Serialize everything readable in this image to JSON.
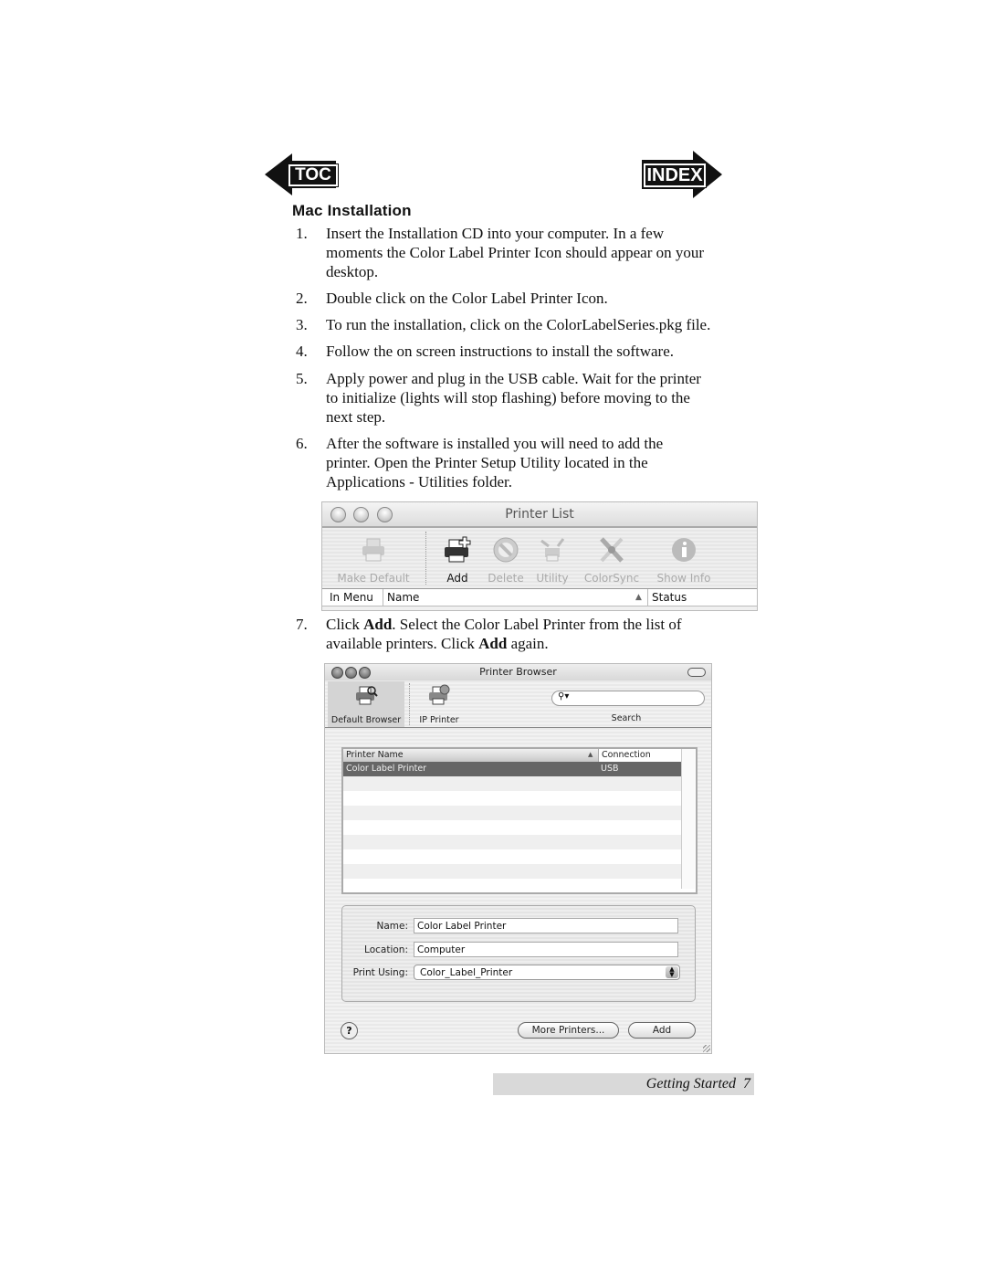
{
  "nav": {
    "toc_label": "TOC",
    "index_label": "INDEX"
  },
  "heading": "Mac Installation",
  "steps": [
    {
      "num": "1.",
      "lines": [
        "Insert the Installation CD into your computer. In a few",
        "moments the Color Label Printer Icon should appear on your",
        "desktop."
      ]
    },
    {
      "num": "2.",
      "lines": [
        "Double click on the Color Label Printer Icon."
      ]
    },
    {
      "num": "3.",
      "lines": [
        "To run the installation, click on the ColorLabelSeries.pkg file."
      ]
    },
    {
      "num": "4.",
      "lines": [
        "Follow the on screen instructions to install the software."
      ]
    },
    {
      "num": "5.",
      "lines": [
        "Apply power and plug in the USB cable.  Wait for the printer",
        "to initialize (lights will stop flashing) before moving to the",
        "next step."
      ]
    },
    {
      "num": "6.",
      "lines": [
        "After the software is installed you will need to add the",
        "printer.  Open the Printer Setup Utility located in the",
        "Applications - Utilities folder."
      ]
    },
    {
      "num": "7.",
      "parts": {
        "a": "Click ",
        "b": "Add",
        "c": ".  Select the Color Label Printer from the list of",
        "d": "available printers. Click ",
        "e": "Add",
        "f": " again."
      }
    }
  ],
  "printer_list": {
    "title": "Printer List",
    "toolbar": [
      {
        "label": "Make Default",
        "icon": "printer-icon",
        "enabled": false
      },
      {
        "label": "Add",
        "icon": "add-printer-icon",
        "enabled": true
      },
      {
        "label": "Delete",
        "icon": "delete-icon",
        "enabled": false
      },
      {
        "label": "Utility",
        "icon": "utility-icon",
        "enabled": false
      },
      {
        "label": "ColorSync",
        "icon": "colorsync-icon",
        "enabled": false
      },
      {
        "label": "Show Info",
        "icon": "info-icon",
        "enabled": false
      }
    ],
    "columns": [
      "In Menu",
      "Name",
      "Status"
    ],
    "sort_indicator": "▲"
  },
  "printer_browser": {
    "title": "Printer Browser",
    "toolbar": [
      {
        "label": "Default Browser",
        "icon": "default-browser-icon",
        "selected": true
      },
      {
        "label": "IP Printer",
        "icon": "ip-printer-icon",
        "selected": false
      }
    ],
    "search_label": "Search",
    "search_placeholder": "",
    "list_columns": [
      "Printer Name",
      "Connection"
    ],
    "sort_indicator": "▲",
    "rows": [
      {
        "name": "Color Label Printer",
        "connection": "USB",
        "selected": true
      }
    ],
    "form": {
      "name_label": "Name:",
      "name_value": "Color Label Printer",
      "location_label": "Location:",
      "location_value": "Computer",
      "print_using_label": "Print Using:",
      "print_using_value": "Color_Label_Printer"
    },
    "help_label": "?",
    "more_printers_label": "More Printers...",
    "add_label": "Add"
  },
  "footer": {
    "section": "Getting Started",
    "page": "7"
  }
}
